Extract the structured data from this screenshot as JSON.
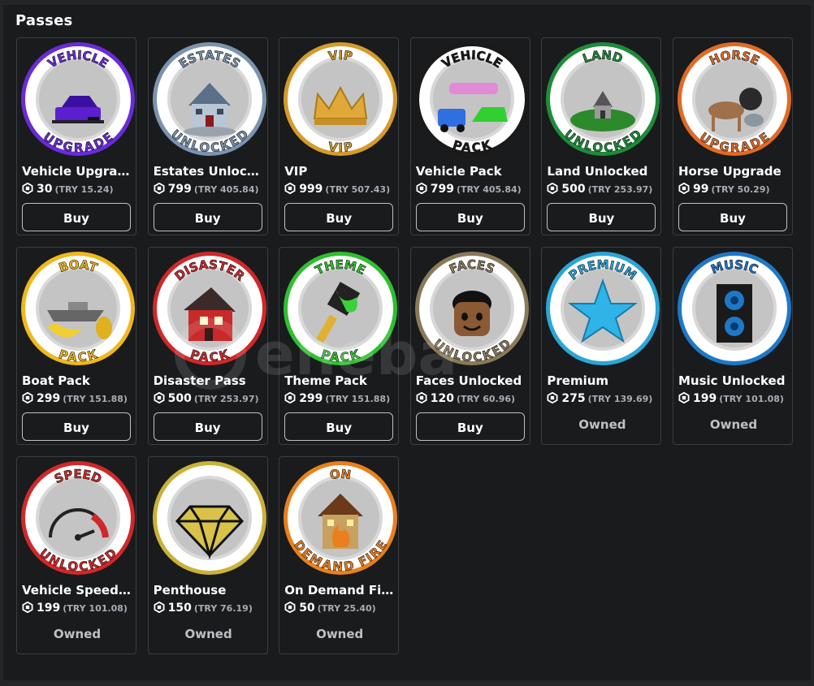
{
  "section_title": "Passes",
  "buy_label": "Buy",
  "owned_label": "Owned",
  "watermark_text": "eneba",
  "passes": [
    {
      "name": "Vehicle Upgrade",
      "price": "30",
      "try": "(TRY 15.24)",
      "status": "buy",
      "ring": "#6a2bd9",
      "top": "VEHICLE",
      "bottom": "UPGRADE",
      "art": "car",
      "art_color": "#5b1fd0"
    },
    {
      "name": "Estates Unlocked",
      "price": "799",
      "try": "(TRY 405.84)",
      "status": "buy",
      "ring": "#7b93ad",
      "top": "ESTATES",
      "bottom": "UNLOCKED",
      "art": "house",
      "art_color": "#7d8fa5"
    },
    {
      "name": "VIP",
      "price": "999",
      "try": "(TRY 507.43)",
      "status": "buy",
      "ring": "#d59b2a",
      "top": "VIP",
      "bottom": "VIP",
      "art": "crown",
      "art_color": "#e0a838"
    },
    {
      "name": "Vehicle Pack",
      "price": "799",
      "try": "(TRY 405.84)",
      "status": "buy",
      "ring": "#1a1a1a",
      "top": "VEHICLE",
      "bottom": "PACK",
      "art": "cars",
      "art_color": "#2f8be0"
    },
    {
      "name": "Land Unlocked",
      "price": "500",
      "try": "(TRY 253.97)",
      "status": "buy",
      "ring": "#1f8b3a",
      "top": "LAND",
      "bottom": "UNLOCKED",
      "art": "island",
      "art_color": "#2c8a2c"
    },
    {
      "name": "Horse Upgrade",
      "price": "99",
      "try": "(TRY 50.29)",
      "status": "buy",
      "ring": "#e06a26",
      "top": "HORSE",
      "bottom": "UPGRADE",
      "art": "horse",
      "art_color": "#8a5a3a"
    },
    {
      "name": "Boat Pack",
      "price": "299",
      "try": "(TRY 151.88)",
      "status": "buy",
      "ring": "#f0b81c",
      "top": "BOAT",
      "bottom": "PACK",
      "art": "boat",
      "art_color": "#f0d030"
    },
    {
      "name": "Disaster Pass",
      "price": "500",
      "try": "(TRY 253.97)",
      "status": "buy",
      "ring": "#d0282a",
      "top": "DISASTER",
      "bottom": "PACK",
      "art": "ruin",
      "art_color": "#c82a2a"
    },
    {
      "name": "Theme Pack",
      "price": "299",
      "try": "(TRY 151.88)",
      "status": "buy",
      "ring": "#2fbf2f",
      "top": "THEME",
      "bottom": "PACK",
      "art": "brush",
      "art_color": "#3ad13a"
    },
    {
      "name": "Faces Unlocked",
      "price": "120",
      "try": "(TRY 60.96)",
      "status": "buy",
      "ring": "#8a7a5a",
      "top": "FACES",
      "bottom": "UNLOCKED",
      "art": "face",
      "art_color": "#8a5a35"
    },
    {
      "name": "Premium",
      "price": "275",
      "try": "(TRY 139.69)",
      "status": "owned",
      "ring": "#2aa6d8",
      "top": "PREMIUM",
      "bottom": "",
      "art": "star",
      "art_color": "#2eb4e8"
    },
    {
      "name": "Music Unlocked",
      "price": "199",
      "try": "(TRY 101.08)",
      "status": "owned",
      "ring": "#1e78c8",
      "top": "MUSIC",
      "bottom": "",
      "art": "speaker",
      "art_color": "#1a1a1a"
    },
    {
      "name": "Vehicle Speed U...",
      "price": "199",
      "try": "(TRY 101.08)",
      "status": "owned",
      "ring": "#d0282a",
      "top": "SPEED",
      "bottom": "UNLOCKED",
      "art": "gauge",
      "art_color": "#d0282a"
    },
    {
      "name": "Penthouse",
      "price": "150",
      "try": "(TRY 76.19)",
      "status": "owned",
      "ring": "#c9b23a",
      "top": "",
      "bottom": "",
      "art": "diamond",
      "art_color": "#d8c24a"
    },
    {
      "name": "On Demand Fire",
      "price": "50",
      "try": "(TRY 25.40)",
      "status": "owned",
      "ring": "#e8801e",
      "top": "ON",
      "bottom": "DEMAND FIRE",
      "art": "fire",
      "art_color": "#e8801e"
    }
  ]
}
